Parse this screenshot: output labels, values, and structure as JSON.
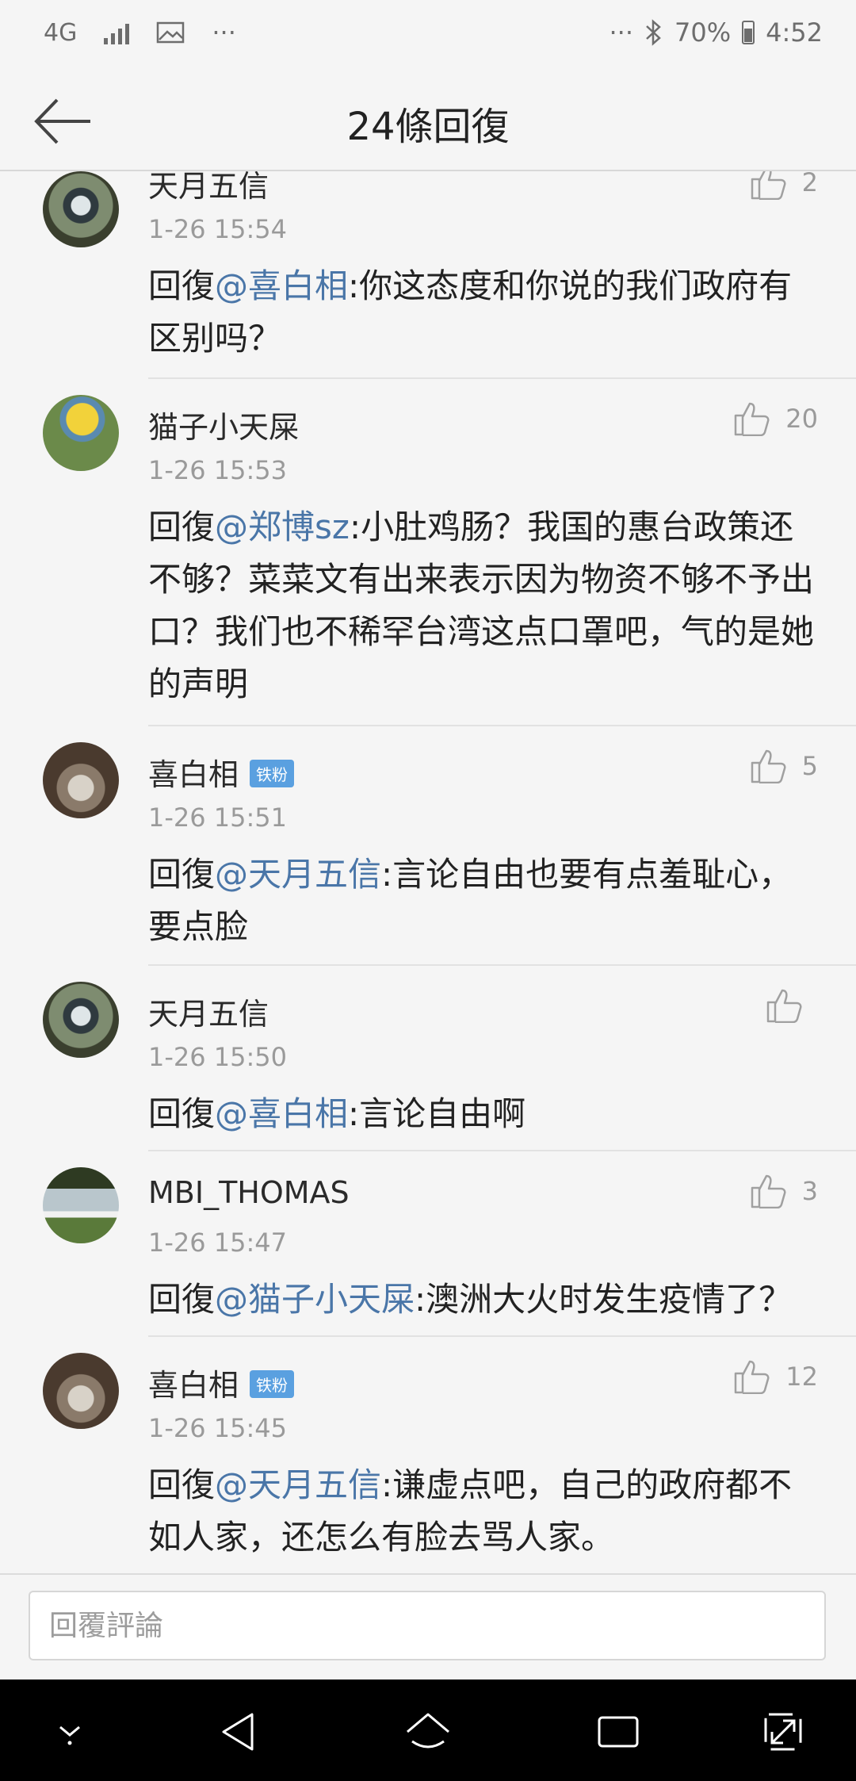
{
  "status_bar": {
    "network": "4G",
    "overflow_left": "···",
    "overflow_right": "···",
    "battery": "70%",
    "time": "4:52"
  },
  "header": {
    "title": "24條回復"
  },
  "comments": [
    {
      "name": "天月五信",
      "badge": "",
      "time": "1-26 15:54",
      "likes": "2",
      "prefix": "回復",
      "mention": "@喜白相",
      "body": ":你这态度和你说的我们政府有区别吗？",
      "avatar_color": "#3a3f2e"
    },
    {
      "name": "猫子小天屎",
      "badge": "",
      "time": "1-26 15:53",
      "likes": "20",
      "prefix": "回復",
      "mention": "@郑博sz",
      "body": ":小肚鸡肠？我国的惠台政策还不够？菜菜文有出来表示因为物资不够不予出口？我们也不稀罕台湾这点口罩吧，气的是她的声明",
      "avatar_color": "#6b8a4a"
    },
    {
      "name": "喜白相",
      "badge": "铁粉",
      "time": "1-26 15:51",
      "likes": "5",
      "prefix": "回復",
      "mention": "@天月五信",
      "body": ":言论自由也要有点羞耻心，要点脸",
      "avatar_color": "#7a6a5a"
    },
    {
      "name": "天月五信",
      "badge": "",
      "time": "1-26 15:50",
      "likes": "",
      "prefix": "回復",
      "mention": "@喜白相",
      "body": ":言论自由啊",
      "avatar_color": "#3a3f2e"
    },
    {
      "name": "MBI_THOMAS",
      "badge": "",
      "time": "1-26 15:47",
      "likes": "3",
      "prefix": "回復",
      "mention": "@猫子小天屎",
      "body": ":澳洲大火时发生疫情了？",
      "avatar_color": "#5a7a3a"
    },
    {
      "name": "喜白相",
      "badge": "铁粉",
      "time": "1-26 15:45",
      "likes": "12",
      "prefix": "回復",
      "mention": "@天月五信",
      "body": ":谦虚点吧，自己的政府都不如人家，还怎么有脸去骂人家。",
      "avatar_color": "#7a6a5a"
    }
  ],
  "reply_box": {
    "placeholder": "回覆評論"
  },
  "icons": {
    "back": "arrow-left-icon",
    "like": "thumbs-up-icon",
    "signal": "signal-bars-icon",
    "gallery": "image-icon",
    "bluetooth": "bluetooth-icon",
    "battery": "battery-icon",
    "nav_down": "chevron-down-icon",
    "nav_back": "triangle-back-icon",
    "nav_home": "home-icon",
    "nav_recent": "recent-apps-icon",
    "nav_expand": "expand-icon"
  }
}
